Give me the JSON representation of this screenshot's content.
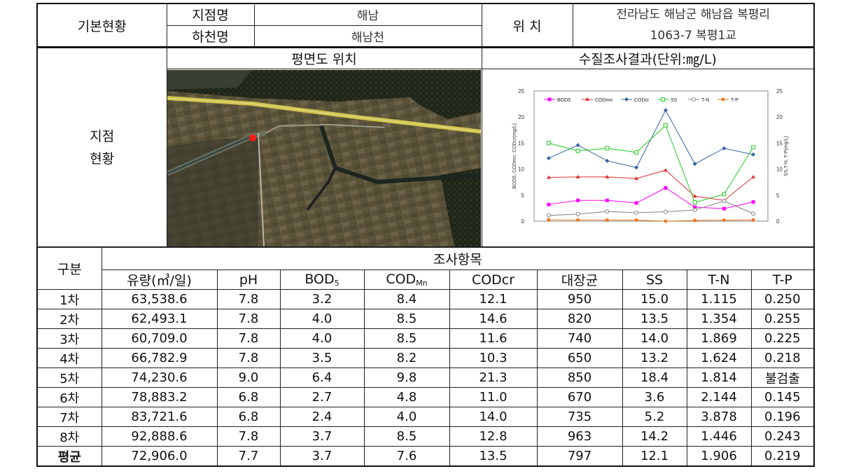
{
  "header": {
    "basic_label": "기본현황",
    "site_name_label": "지점명",
    "site_name_value": "해남",
    "river_label": "하천명",
    "river_value": "해남천",
    "location_label": "위 치",
    "location_line1": "전라남도 해남군 해남읍 복평리",
    "location_line2": "1063-7 복평1교"
  },
  "section": {
    "status_label_1": "지점",
    "status_label_2": "현황",
    "map_title": "평면도 위치",
    "chart_title": "수질조사결과(단위:㎎/L)"
  },
  "chart_data": {
    "type": "line",
    "x": [
      1,
      2,
      3,
      4,
      5,
      6,
      7,
      8
    ],
    "left_axis": {
      "label": "BOD5, CODmn, CODcr(mg/L)",
      "ylim": [
        0,
        25
      ],
      "ticks": [
        "0",
        "5",
        "10",
        "15",
        "20",
        "25"
      ]
    },
    "right_axis": {
      "label": "SS,T-N, T-P(mg/L)",
      "ylim": [
        0,
        25
      ],
      "ticks": [
        "0",
        "5",
        "10",
        "15",
        "20",
        "25"
      ]
    },
    "legend_position": "top",
    "series": [
      {
        "name": "BOD5",
        "axis": "left",
        "color": "#ff00ff",
        "marker": "square",
        "values": [
          3.2,
          4.0,
          4.0,
          3.5,
          6.4,
          2.7,
          2.4,
          3.7
        ]
      },
      {
        "name": "CODmn",
        "axis": "left",
        "color": "#e03030",
        "marker": "triangle",
        "values": [
          8.4,
          8.5,
          8.5,
          8.2,
          9.8,
          4.8,
          4.0,
          8.5
        ]
      },
      {
        "name": "CODcr",
        "axis": "left",
        "color": "#3465a4",
        "marker": "diamond",
        "values": [
          12.1,
          14.6,
          11.6,
          10.3,
          21.3,
          11.0,
          14.0,
          12.8
        ]
      },
      {
        "name": "SS",
        "axis": "right",
        "color": "#22cc22",
        "marker": "square-open",
        "values": [
          15.0,
          13.5,
          14.0,
          13.2,
          18.4,
          3.6,
          5.2,
          14.2
        ]
      },
      {
        "name": "T-N",
        "axis": "right",
        "color": "#808080",
        "marker": "circle-open",
        "values": [
          1.115,
          1.354,
          1.869,
          1.624,
          1.814,
          2.144,
          3.878,
          1.446
        ]
      },
      {
        "name": "T-P",
        "axis": "right",
        "color": "#f07820",
        "marker": "circle",
        "values": [
          0.25,
          0.255,
          0.225,
          0.218,
          0,
          0.145,
          0.196,
          0.243
        ]
      }
    ]
  },
  "table": {
    "group_label": "구분",
    "items_label": "조사항목",
    "columns": [
      "유량(㎥/일)",
      "pH",
      "BOD",
      "COD",
      "CODcr",
      "대장균",
      "SS",
      "T-N",
      "T-P"
    ],
    "col_sub": {
      "bod": "5",
      "cod": "Mn"
    },
    "rows": [
      {
        "label": "1차",
        "values": [
          "63,538.6",
          "7.8",
          "3.2",
          "8.4",
          "12.1",
          "950",
          "15.0",
          "1.115",
          "0.250"
        ]
      },
      {
        "label": "2차",
        "values": [
          "62,493.1",
          "7.8",
          "4.0",
          "8.5",
          "14.6",
          "820",
          "13.5",
          "1.354",
          "0.255"
        ]
      },
      {
        "label": "3차",
        "values": [
          "60,709.0",
          "7.8",
          "4.0",
          "8.5",
          "11.6",
          "740",
          "14.0",
          "1.869",
          "0.225"
        ]
      },
      {
        "label": "4차",
        "values": [
          "66,782.9",
          "7.8",
          "3.5",
          "8.2",
          "10.3",
          "650",
          "13.2",
          "1.624",
          "0.218"
        ]
      },
      {
        "label": "5차",
        "values": [
          "74,230.6",
          "9.0",
          "6.4",
          "9.8",
          "21.3",
          "850",
          "18.4",
          "1.814",
          "불검출"
        ]
      },
      {
        "label": "6차",
        "values": [
          "78,883.2",
          "6.8",
          "2.7",
          "4.8",
          "11.0",
          "670",
          "3.6",
          "2.144",
          "0.145"
        ]
      },
      {
        "label": "7차",
        "values": [
          "83,721.6",
          "6.8",
          "2.4",
          "4.0",
          "14.0",
          "735",
          "5.2",
          "3.878",
          "0.196"
        ]
      },
      {
        "label": "8차",
        "values": [
          "92,888.6",
          "7.8",
          "3.7",
          "8.5",
          "12.8",
          "963",
          "14.2",
          "1.446",
          "0.243"
        ]
      },
      {
        "label": "평균",
        "values": [
          "72,906.0",
          "7.7",
          "3.7",
          "7.6",
          "13.5",
          "797",
          "12.1",
          "1.906",
          "0.219"
        ]
      }
    ]
  }
}
